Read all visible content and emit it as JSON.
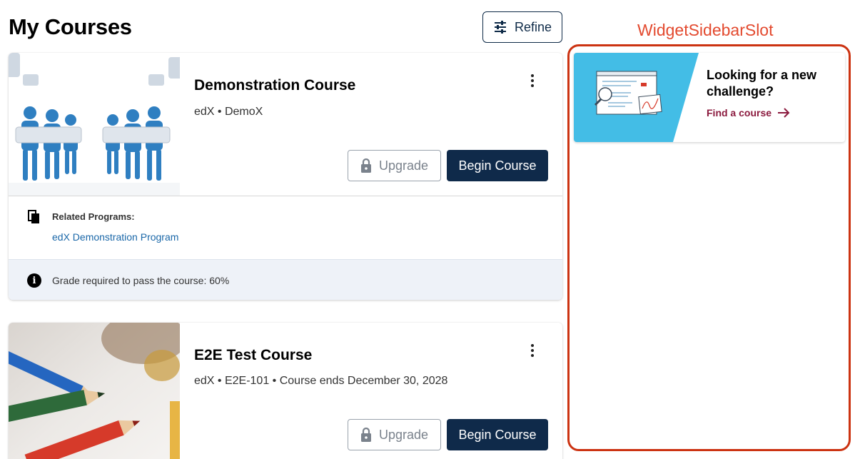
{
  "page": {
    "title": "My Courses",
    "refine_label": "Refine"
  },
  "courses": [
    {
      "title": "Demonstration Course",
      "subtitle": "edX • DemoX",
      "upgrade_label": "Upgrade",
      "begin_label": "Begin Course",
      "related_programs_label": "Related Programs:",
      "related_program_link": "edX Demonstration Program",
      "grade_notice": "Grade required to pass the course: 60%"
    },
    {
      "title": "E2E Test Course",
      "subtitle": "edX • E2E-101 • Course ends December 30, 2028",
      "upgrade_label": "Upgrade",
      "begin_label": "Begin Course"
    }
  ],
  "sidebar": {
    "slot_label": "WidgetSidebarSlot",
    "widget": {
      "heading": "Looking for a new challenge?",
      "link_label": "Find a course"
    }
  },
  "colors": {
    "primary": "#0f2a4a",
    "slot_outline": "#cc3312",
    "widget_link": "#8b1a3e",
    "widget_art_bg": "#43bde6",
    "grade_bg": "#eef2f8"
  },
  "icons": {
    "refine": "sliders-icon",
    "upgrade": "lock-icon",
    "menu": "kebab-icon",
    "related": "programs-icon",
    "info": "info-icon",
    "find_course": "arrow-right-icon"
  }
}
